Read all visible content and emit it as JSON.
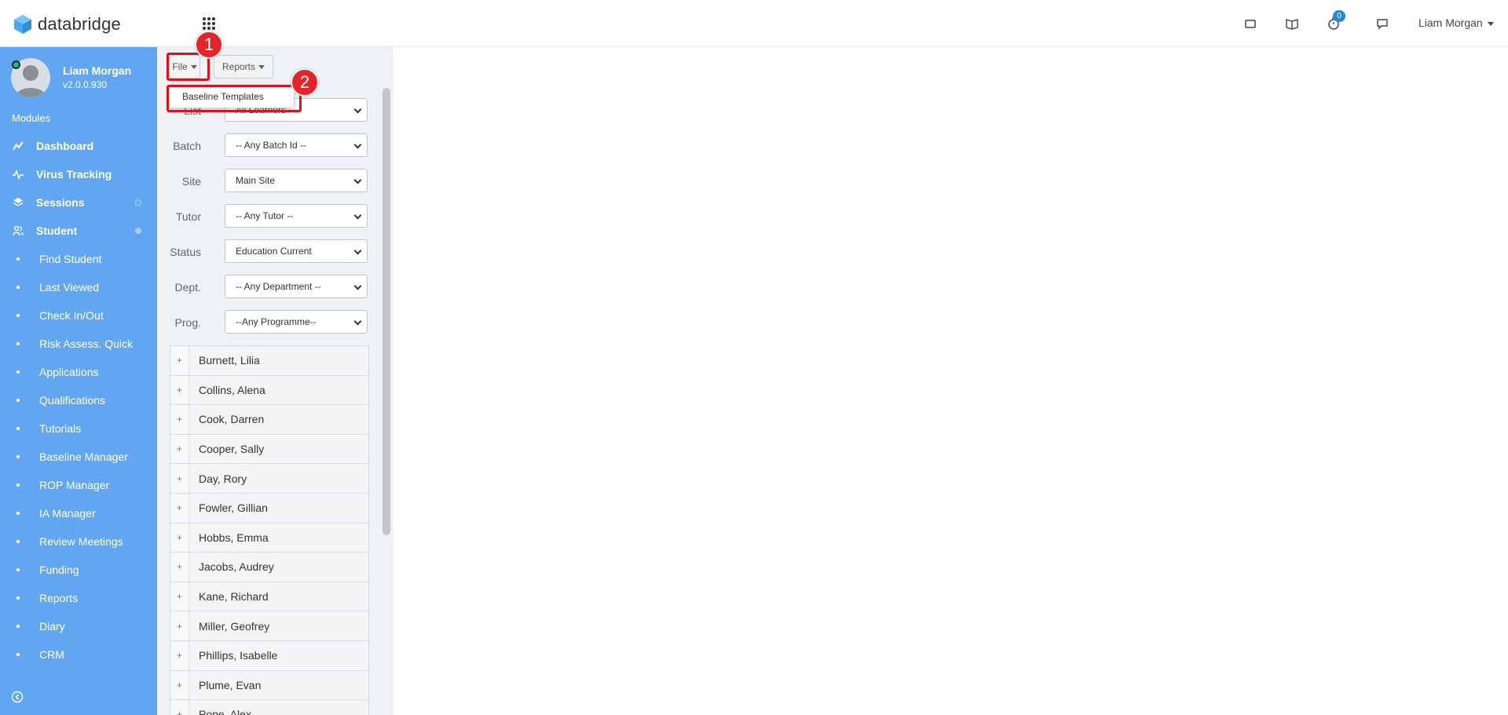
{
  "app": {
    "brand": "databridge",
    "notification_count": "0",
    "user_menu": "Liam Morgan"
  },
  "profile": {
    "name": "Liam Morgan",
    "version": "v2.0.0.930"
  },
  "sidebar": {
    "section_label": "Modules",
    "main_items": [
      {
        "label": "Dashboard",
        "icon": "chart-line-icon"
      },
      {
        "label": "Virus Tracking",
        "icon": "pulse-icon"
      },
      {
        "label": "Sessions",
        "icon": "layers-icon"
      },
      {
        "label": "Student",
        "icon": "users-icon"
      }
    ],
    "sub_items": [
      "Find Student",
      "Last Viewed",
      "Check In/Out",
      "Risk Assess. Quick",
      "Applications",
      "Qualifications",
      "Tutorials",
      "Baseline Manager",
      "ROP Manager",
      "IA Manager",
      "Review Meetings",
      "Funding",
      "Reports",
      "Diary",
      "CRM"
    ]
  },
  "toolbar": {
    "file_label": "File",
    "reports_label": "Reports"
  },
  "file_menu": {
    "items": [
      "Baseline Templates"
    ]
  },
  "filters": [
    {
      "label": "List",
      "value": "All Learners"
    },
    {
      "label": "Batch",
      "value": "-- Any Batch Id --"
    },
    {
      "label": "Site",
      "value": "Main Site"
    },
    {
      "label": "Tutor",
      "value": "-- Any Tutor --"
    },
    {
      "label": "Status",
      "value": "Education Current"
    },
    {
      "label": "Dept.",
      "value": "-- Any Department --"
    },
    {
      "label": "Prog.",
      "value": "--Any Programme--"
    }
  ],
  "students": [
    "Burnett, Lilia",
    "Collins, Alena",
    "Cook, Darren",
    "Cooper, Sally",
    "Day, Rory",
    "Fowler, Gillian",
    "Hobbs, Emma",
    "Jacobs, Audrey",
    "Kane, Richard",
    "Miller, Geofrey",
    "Phillips, Isabelle",
    "Plume, Evan",
    "Pope, Alex"
  ],
  "annotations": {
    "step1": "1",
    "step2": "2",
    "color": "#d6161c"
  },
  "colors": {
    "sidebar_bg": "#62a6f2",
    "panel_bg": "#eef2f7"
  }
}
